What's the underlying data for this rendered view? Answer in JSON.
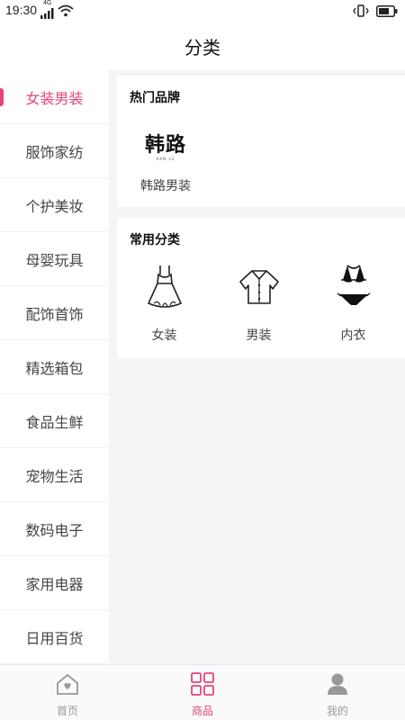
{
  "status_bar": {
    "time": "19:30",
    "network": "4G"
  },
  "header": {
    "title": "分类"
  },
  "sidebar": {
    "items": [
      {
        "label": "女装男装",
        "active": true
      },
      {
        "label": "服饰家纺"
      },
      {
        "label": "个护美妆"
      },
      {
        "label": "母婴玩具"
      },
      {
        "label": "配饰首饰"
      },
      {
        "label": "精选箱包"
      },
      {
        "label": "食品生鲜"
      },
      {
        "label": "宠物生活"
      },
      {
        "label": "数码电子"
      },
      {
        "label": "家用电器"
      },
      {
        "label": "日用百货"
      }
    ]
  },
  "hot_brands": {
    "title": "热门品牌",
    "brands": [
      {
        "logo_text": "韩路",
        "logo_sub": "HAN LU",
        "name": "韩路男装"
      }
    ]
  },
  "common_categories": {
    "title": "常用分类",
    "items": [
      {
        "label": "女装",
        "icon": "dress-icon"
      },
      {
        "label": "男装",
        "icon": "shirt-icon"
      },
      {
        "label": "内衣",
        "icon": "bikini-icon"
      }
    ]
  },
  "tabbar": {
    "tabs": [
      {
        "label": "首页",
        "icon": "home-icon"
      },
      {
        "label": "商品",
        "icon": "grid-icon",
        "active": true
      },
      {
        "label": "我的",
        "icon": "user-icon"
      }
    ]
  },
  "colors": {
    "accent": "#e2467a",
    "background": "#f5f5f7"
  }
}
